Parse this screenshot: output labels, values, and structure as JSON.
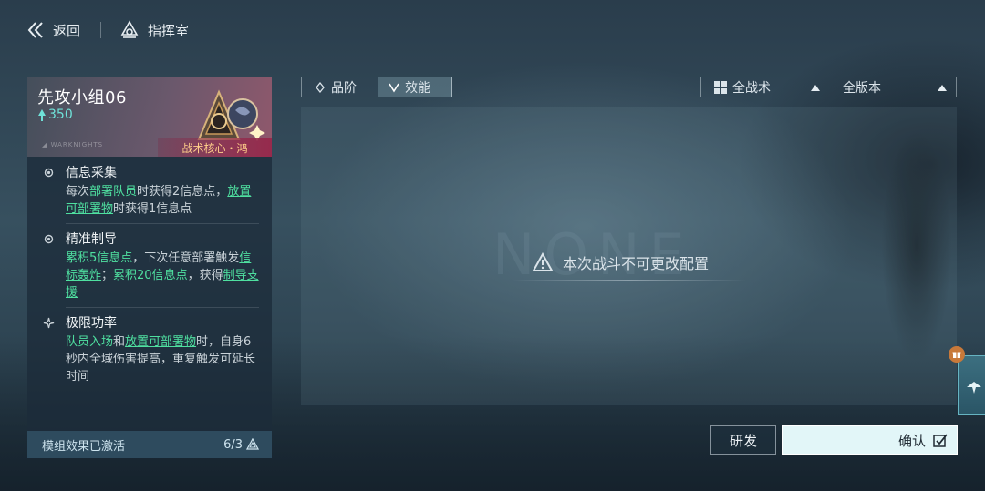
{
  "nav": {
    "back_label": "返回",
    "breadcrumb_label": "指挥室"
  },
  "squad": {
    "name": "先攻小组06",
    "cost": "350",
    "core_tag": "战术核心・鸿",
    "skills": [
      {
        "title": "信息采集",
        "desc": [
          {
            "t": "每次",
            "s": "n"
          },
          {
            "t": "部署队员",
            "s": "k"
          },
          {
            "t": "时获得2信息点，",
            "s": "n"
          },
          {
            "t": "放置可部署物",
            "s": "u"
          },
          {
            "t": "时获得1信息点",
            "s": "n"
          }
        ]
      },
      {
        "title": "精准制导",
        "desc": [
          {
            "t": "累积5信息点",
            "s": "k"
          },
          {
            "t": "，下次任意部署触发",
            "s": "n"
          },
          {
            "t": "信标轰炸",
            "s": "u"
          },
          {
            "t": "；",
            "s": "n"
          },
          {
            "t": "累积20信息点",
            "s": "k"
          },
          {
            "t": "，获得",
            "s": "n"
          },
          {
            "t": "制导支援",
            "s": "u"
          }
        ]
      },
      {
        "title": "极限功率",
        "desc": [
          {
            "t": "队员入场",
            "s": "k"
          },
          {
            "t": "和",
            "s": "n"
          },
          {
            "t": "放置可部署物",
            "s": "u"
          },
          {
            "t": "时，自身6秒内全域伤害提高，重复触发可延长时间",
            "s": "n"
          }
        ]
      }
    ],
    "module_status": "模组效果已激活",
    "module_count": "6/3"
  },
  "filters": {
    "tab_grade": "品阶",
    "tab_perf": "效能",
    "tactic": "全战术",
    "version": "全版本"
  },
  "content": {
    "notice": "本次战斗不可更改配置"
  },
  "actions": {
    "research": "研发",
    "confirm": "确认"
  },
  "colors": {
    "keyword": "#4fe0a0",
    "cost": "#6fe1d8",
    "core_tag_text": "#ffcf8a",
    "confirm_bg": "#e2f6f8"
  }
}
